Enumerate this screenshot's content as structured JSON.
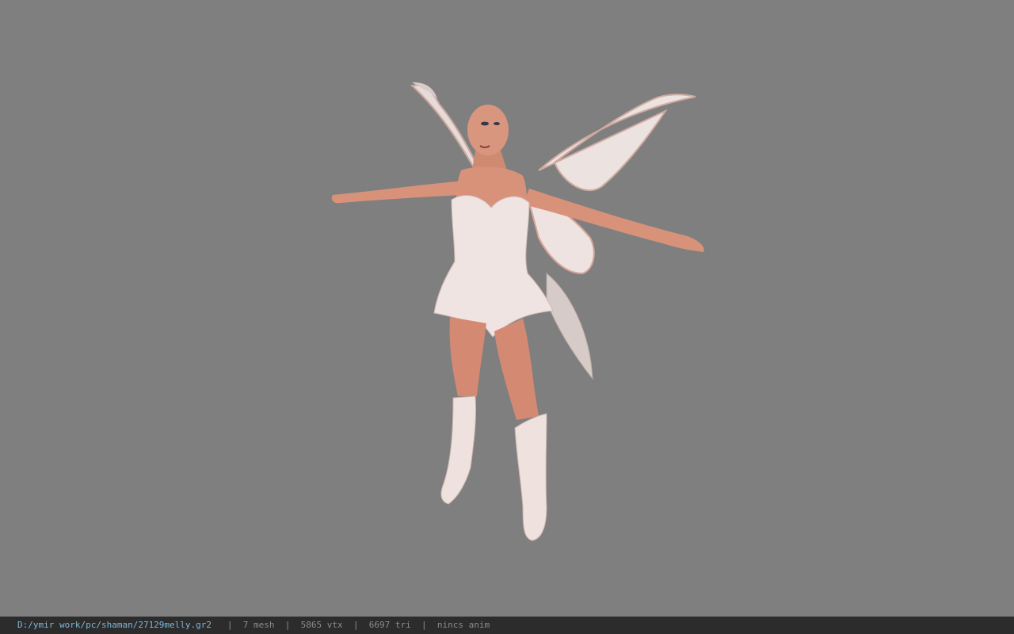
{
  "viewer": {
    "background_color": "#7f7f7f",
    "model": {
      "description_icon": "fairy-character-model",
      "skin_color": "#d9927a",
      "dress_color": "#efe4e1",
      "wing_color": "#e8dcd9",
      "wing_edge_color": "#d6a59a"
    }
  },
  "status_bar": {
    "background_color": "#2c2c2c",
    "file_path": "D:/ymir work/pc/shaman/27129melly.gr2",
    "separator": "|",
    "mesh": "7 mesh",
    "vertices": "5865 vtx",
    "triangles": "6697 tri",
    "animation": "nincs anim"
  }
}
